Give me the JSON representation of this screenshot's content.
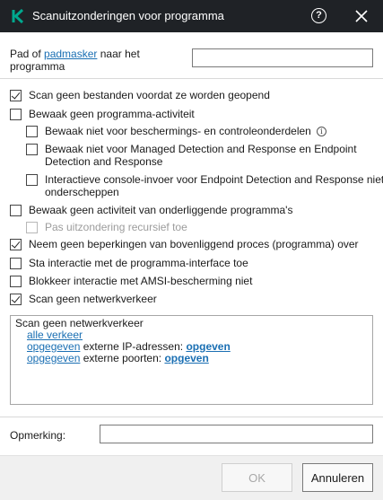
{
  "window": {
    "title": "Scanuitzonderingen voor programma",
    "help_glyph": "?",
    "logo_icon": "kaspersky-k-logo",
    "accent_color": "#00a88e"
  },
  "path": {
    "label_prefix": "Pad of ",
    "label_link": "padmasker",
    "label_suffix": " naar het programma",
    "value": ""
  },
  "options": [
    {
      "label": "Scan geen bestanden voordat ze worden geopend",
      "checked": true,
      "disabled": false
    },
    {
      "label": "Bewaak geen programma-activiteit",
      "checked": false,
      "disabled": false
    },
    {
      "label": "Bewaak niet voor beschermings- en controleonderdelen",
      "checked": false,
      "disabled": false,
      "info_glyph": "i"
    },
    {
      "label": "Bewaak niet voor Managed Detection and Response en Endpoint Detection and Response",
      "checked": false,
      "disabled": false
    },
    {
      "label": "Interactieve console-invoer voor Endpoint Detection and Response niet onderscheppen",
      "checked": false,
      "disabled": false
    },
    {
      "label": "Bewaak geen activiteit van onderliggende programma's",
      "checked": false,
      "disabled": false
    },
    {
      "label": "Pas uitzondering recursief toe",
      "checked": false,
      "disabled": true
    },
    {
      "label": "Neem geen beperkingen van bovenliggend proces (programma) over",
      "checked": true,
      "disabled": false
    },
    {
      "label": "Sta interactie met de programma-interface toe",
      "checked": false,
      "disabled": false
    },
    {
      "label": "Blokkeer interactie met AMSI-bescherming niet",
      "checked": false,
      "disabled": false
    },
    {
      "label": "Scan geen netwerkverkeer",
      "checked": true,
      "disabled": false
    }
  ],
  "scan_box": {
    "heading": "Scan geen netwerkverkeer",
    "all_traffic_link": "alle verkeer",
    "ip_link1": "opgegeven",
    "ip_text": " externe IP-adressen: ",
    "ip_link2": "opgeven",
    "port_link1": "opgegeven",
    "port_text": " externe poorten: ",
    "port_link2": "opgeven"
  },
  "comment": {
    "label": "Opmerking:",
    "value": ""
  },
  "buttons": {
    "ok": "OK",
    "cancel": "Annuleren"
  }
}
